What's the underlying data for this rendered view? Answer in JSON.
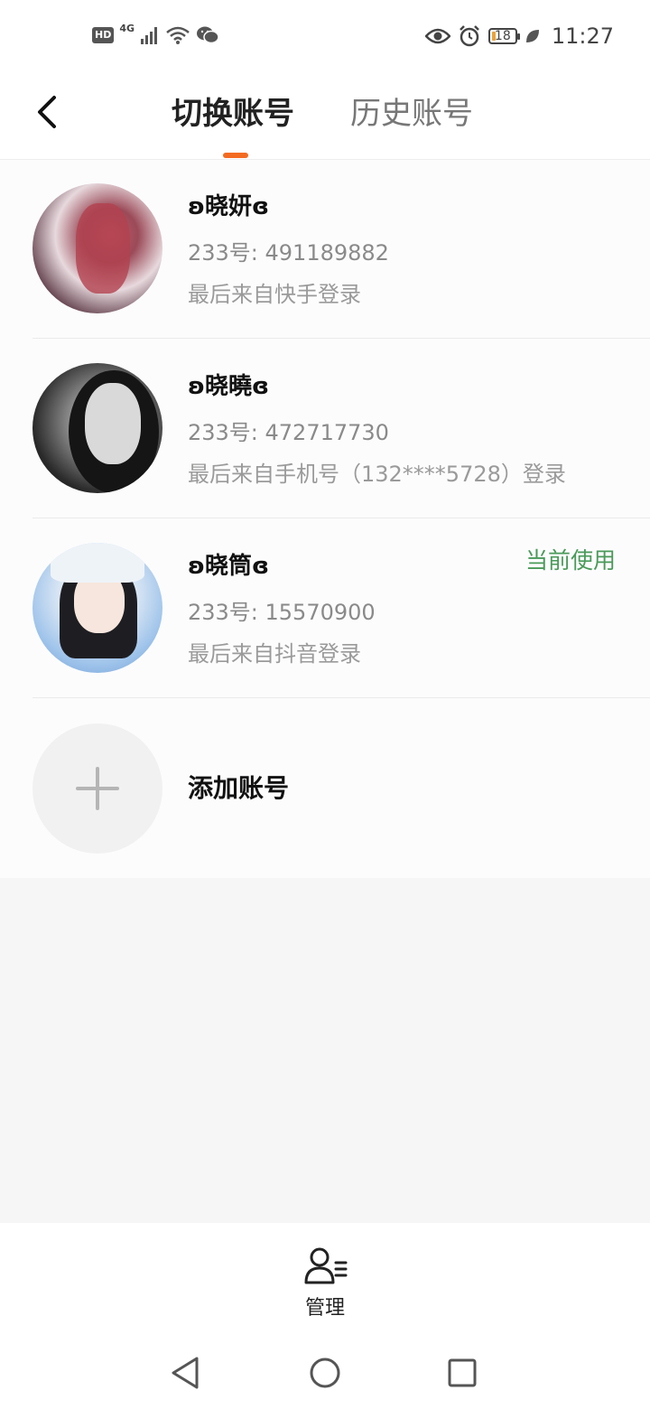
{
  "status_bar": {
    "hd": "HD",
    "network": "4G",
    "time": "11:27",
    "battery": "18",
    "icons": [
      "hd-icon",
      "signal-icon",
      "wifi-icon",
      "wechat-icon",
      "eye-icon",
      "alarm-icon",
      "battery-icon",
      "leaf-icon"
    ]
  },
  "header": {
    "back_icon": "chevron-left-icon",
    "tabs": [
      {
        "label": "切换账号",
        "active": true
      },
      {
        "label": "历史账号",
        "active": false
      }
    ],
    "accent_color": "#f36b21"
  },
  "accounts": [
    {
      "name": "ʚ晓妍ɞ",
      "uid": "233号: 491189882",
      "source": "最后来自快手登录",
      "current": ""
    },
    {
      "name": "ʚ晓曉ɞ",
      "uid": "233号: 472717730",
      "source": "最后来自手机号（132****5728）登录",
      "current": ""
    },
    {
      "name": "ʚ晓筒ɞ",
      "uid": "233号: 15570900",
      "source": "最后来自抖音登录",
      "current": "当前使用"
    }
  ],
  "current_color": "#4a9a59",
  "add_account": {
    "label": "添加账号",
    "icon": "plus-icon"
  },
  "bottom": {
    "manage_label": "管理",
    "manage_icon": "user-list-icon"
  },
  "nav": {
    "icons": [
      "back-triangle-icon",
      "home-circle-icon",
      "recent-square-icon"
    ]
  }
}
